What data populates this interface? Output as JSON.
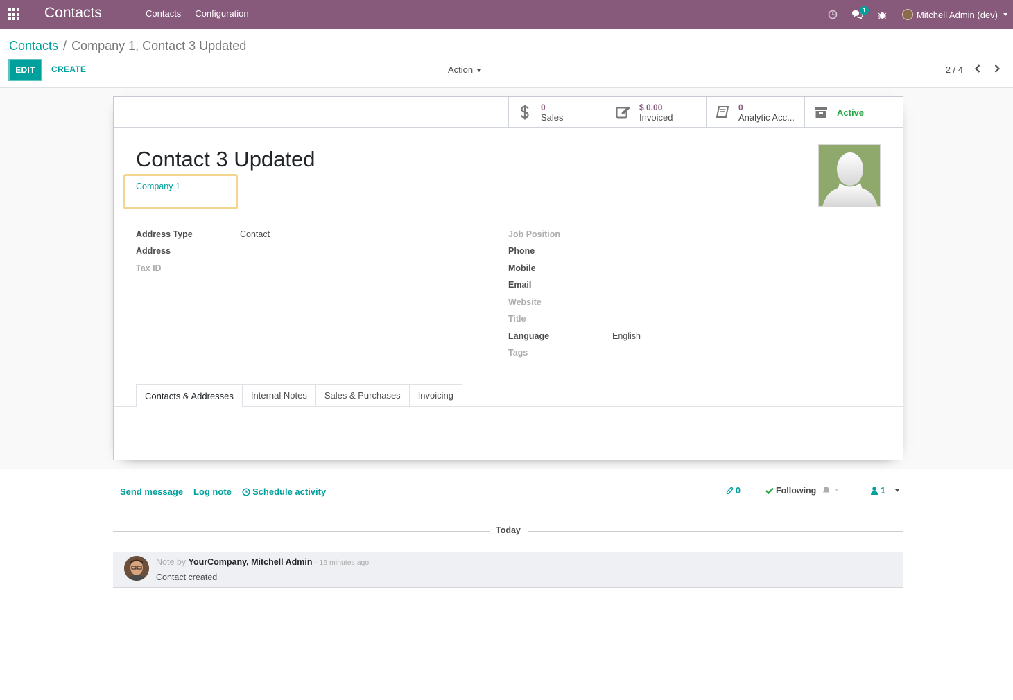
{
  "navbar": {
    "brand": "Contacts",
    "menu": [
      "Contacts",
      "Configuration"
    ],
    "messages_count": "1",
    "user_name": "Mitchell Admin (dev)"
  },
  "control_panel": {
    "breadcrumb": [
      "Contacts",
      "/",
      "Company 1, Contact 3 Updated"
    ],
    "edit_label": "EDIT",
    "create_label": "CREATE",
    "action_label": "Action",
    "pager": "2 / 4"
  },
  "stat_buttons": {
    "sales": {
      "value": "0",
      "label": "Sales"
    },
    "invoiced": {
      "value": "$ 0.00",
      "label": "Invoiced"
    },
    "analytic": {
      "value": "0",
      "label": "Analytic Acc..."
    },
    "active": {
      "label": "Active"
    }
  },
  "record": {
    "name": "Contact 3 Updated",
    "company": "Company 1"
  },
  "left_fields": [
    {
      "label": "Address Type",
      "value": "Contact"
    },
    {
      "label": "Address",
      "value": ""
    },
    {
      "label": "Tax ID",
      "value": ""
    }
  ],
  "right_fields": [
    {
      "label": "Job Position",
      "value": ""
    },
    {
      "label": "Phone",
      "value": ""
    },
    {
      "label": "Mobile",
      "value": ""
    },
    {
      "label": "Email",
      "value": ""
    },
    {
      "label": "Website",
      "value": ""
    },
    {
      "label": "Title",
      "value": ""
    },
    {
      "label": "Language",
      "value": "English"
    },
    {
      "label": "Tags",
      "value": ""
    }
  ],
  "tabs": [
    "Contacts & Addresses",
    "Internal Notes",
    "Sales & Purchases",
    "Invoicing"
  ],
  "chatter": {
    "send_message": "Send message",
    "log_note": "Log note",
    "schedule_activity": "Schedule activity",
    "attachments_count": "0",
    "following": "Following",
    "followers_count": "1",
    "date_separator": "Today",
    "message": {
      "prefix": "Note by",
      "author": "YourCompany, Mitchell Admin",
      "time": "- 15 minutes ago",
      "body": "Contact created"
    }
  },
  "colors": {
    "navbar": "#875a7b",
    "primary": "#00a09d",
    "active": "#28a745",
    "highlight": "#f4d58e"
  }
}
